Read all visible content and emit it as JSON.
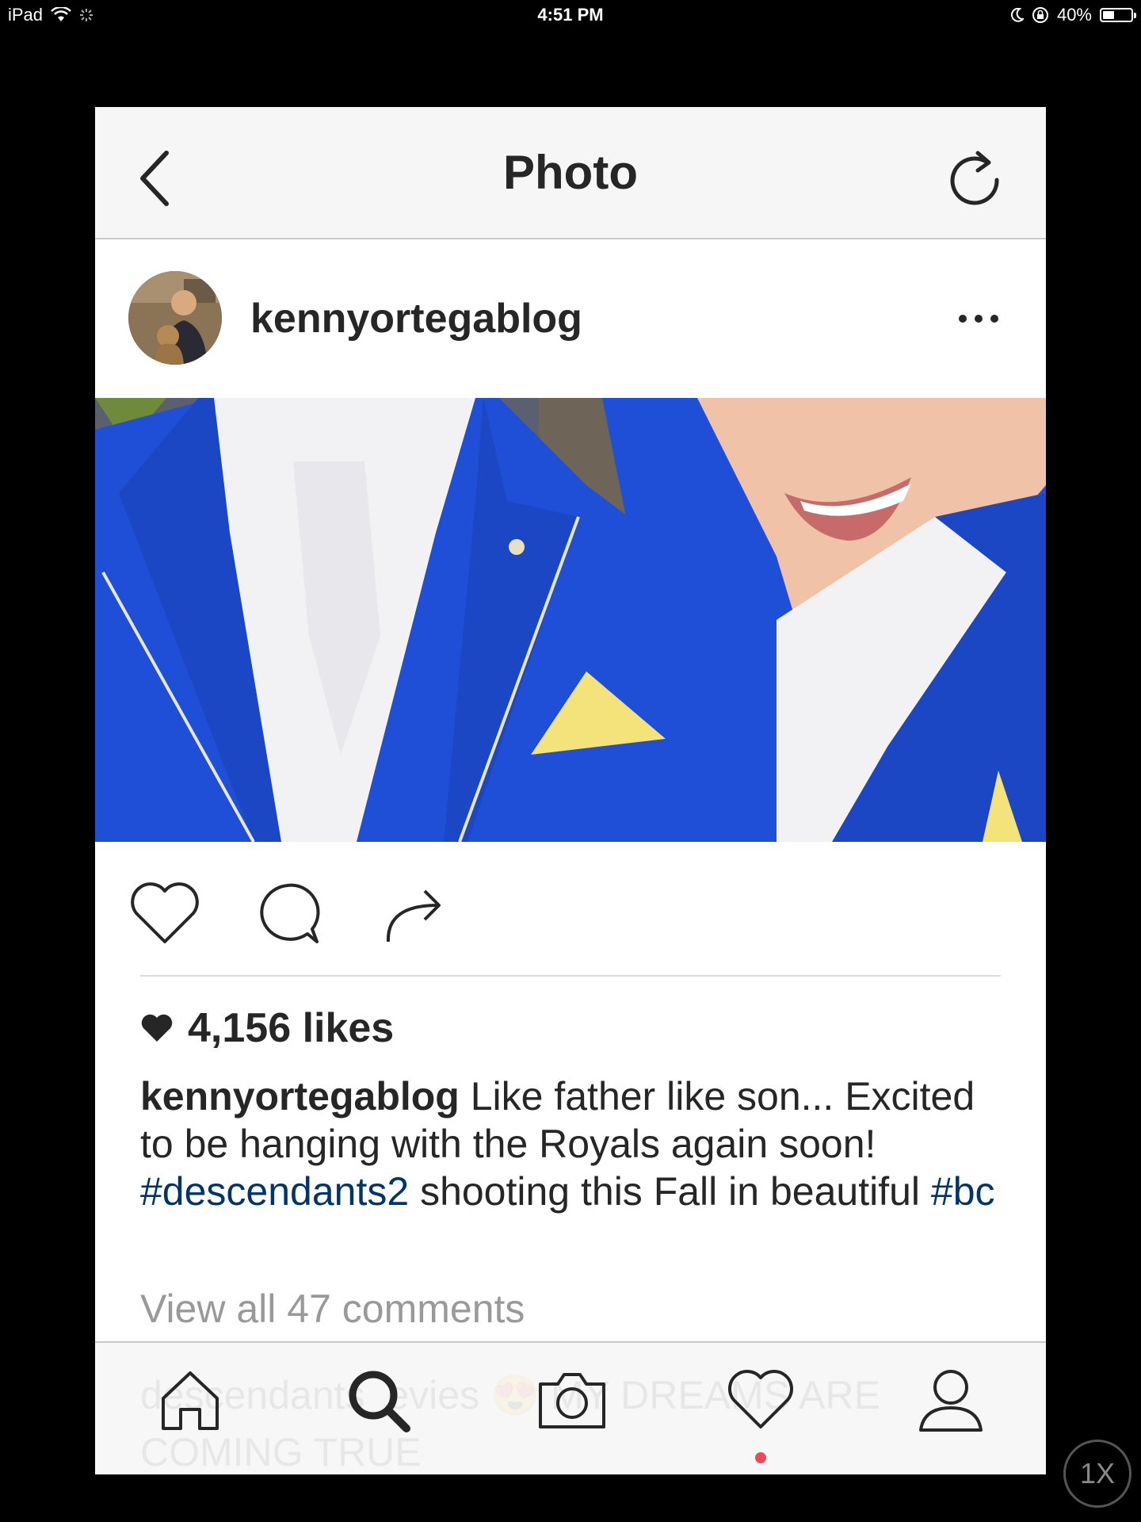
{
  "status_bar": {
    "device": "iPad",
    "time": "4:51 PM",
    "battery": "40%",
    "battery_level": 0.4,
    "icons": [
      "wifi-icon",
      "loading-spinner-icon",
      "moon-icon",
      "rotation-lock-icon",
      "battery-icon"
    ]
  },
  "nav": {
    "title": "Photo",
    "back_icon": "chevron-left-icon",
    "refresh_icon": "refresh-icon"
  },
  "post": {
    "username": "kennyortegablog",
    "more_icon": "more-dots-icon",
    "likes": "4,156 likes",
    "caption": {
      "user": "kennyortegablog",
      "text_1": " Like father like son... Excited to be hanging with the Royals again soon! ",
      "hashtag_1": "#descendants2",
      "text_2": " shooting this Fall in beautiful ",
      "hashtag_2": "#bc"
    },
    "view_comments": "View all 47 comments",
    "next_comment": "descendants_evies 😍 MY DREAMS ARE COMING TRUE"
  },
  "tabs": [
    "home-icon",
    "search-icon",
    "camera-icon",
    "activity-heart-icon",
    "profile-icon"
  ],
  "zoom_label": "1X",
  "colors": {
    "jacket_blue": "#1f4fd6",
    "hashtag_blue": "#003569",
    "notification_red": "#ed4956",
    "pocket_yellow": "#f4e27a"
  }
}
